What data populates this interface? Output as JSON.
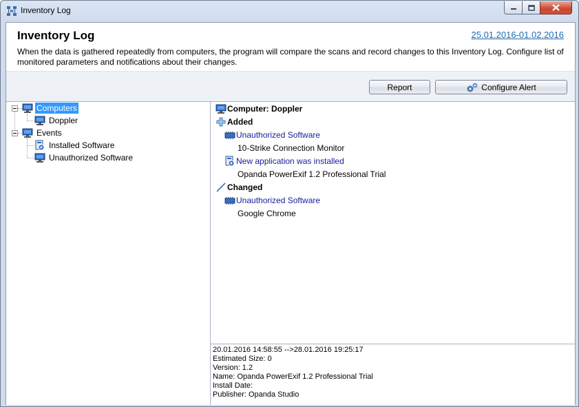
{
  "window": {
    "title": "Inventory Log"
  },
  "header": {
    "title": "Inventory Log",
    "date_range": "25.01.2016-01.02.2016",
    "description": "When the data is gathered repeatedly from computers, the program will compare the scans and record changes to this Inventory Log. Configure list of monitored parameters and notifications about their changes."
  },
  "toolbar": {
    "report_label": "Report",
    "configure_alert_label": "Configure Alert"
  },
  "tree": {
    "computers": "Computers",
    "doppler": "Doppler",
    "events": "Events",
    "installed_software": "Installed Software",
    "unauthorized_software": "Unauthorized Software"
  },
  "log": {
    "computer_heading": "Computer: Doppler",
    "added": "Added",
    "added_items": [
      {
        "event": "Unauthorized Software",
        "name": "10-Strike Connection Monitor"
      },
      {
        "event": "New application was installed",
        "name": "Opanda PowerExif 1.2 Professional Trial"
      }
    ],
    "changed": "Changed",
    "changed_items": [
      {
        "event": "Unauthorized Software",
        "name": "Google Chrome"
      }
    ]
  },
  "details": [
    "20.01.2016 14:58:55 -->28.01.2016 19:25:17",
    "Estimated Size: 0",
    "Version: 1.2",
    "Name: Opanda PowerExif 1.2 Professional Trial",
    "Install Date:",
    "Publisher: Opanda Studio"
  ],
  "colors": {
    "selection": "#3399ff",
    "link": "#1a6ab3",
    "event_link": "#1a1a9a"
  }
}
